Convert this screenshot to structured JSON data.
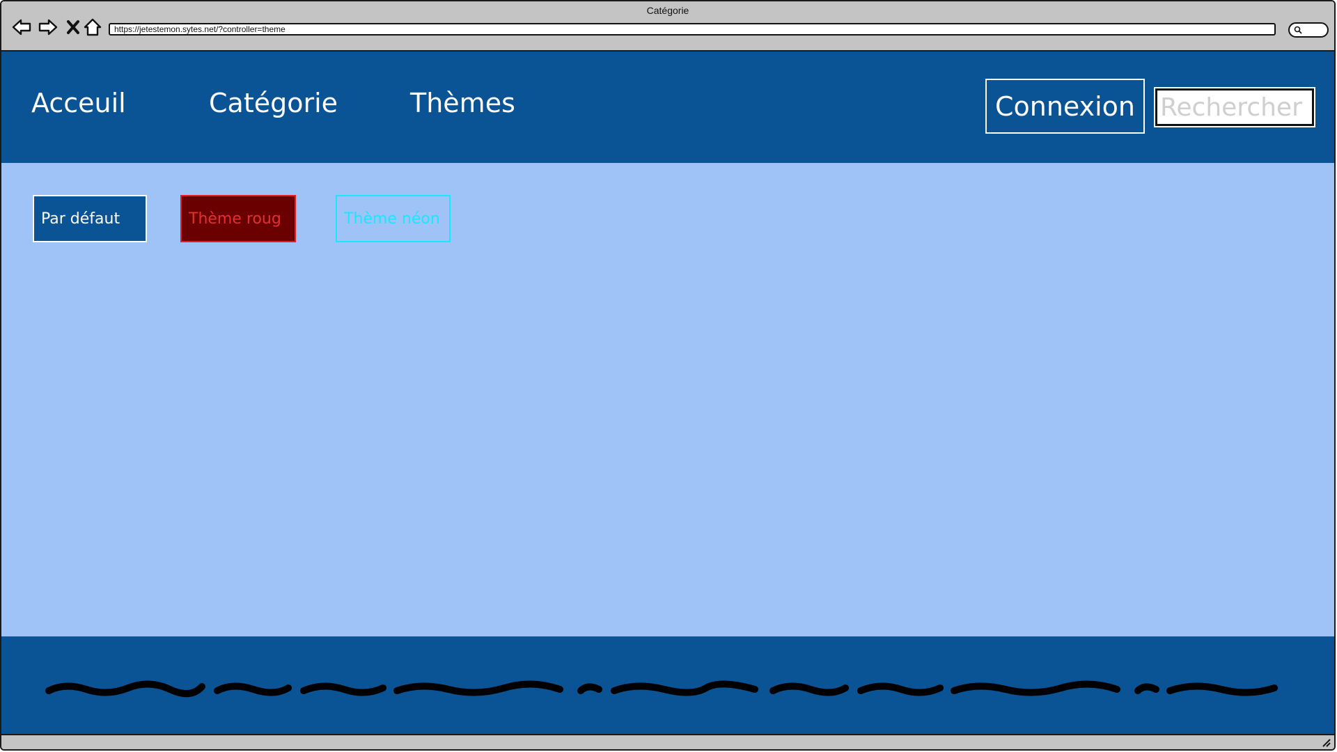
{
  "browser": {
    "window_title": "Catégorie",
    "url": "https://jetestemon.sytes.net/?controller=theme",
    "icons": [
      "back-arrow-icon",
      "forward-arrow-icon",
      "close-x-icon",
      "home-icon",
      "search-icon",
      "resize-grip-icon"
    ]
  },
  "header": {
    "nav": [
      {
        "label": "Acceuil"
      },
      {
        "label": "Catégorie"
      },
      {
        "label": "Thèmes"
      }
    ],
    "login_label": "Connexion",
    "search_placeholder": "Rechercher",
    "background_color": "#0a5395"
  },
  "themes": {
    "buttons": [
      {
        "label": "Par défaut",
        "background": "#0a5395",
        "text_color": "#ffffff"
      },
      {
        "label": "Thème roug",
        "background": "#6b0000",
        "text_color": "#e03030"
      },
      {
        "label": "Thème néon",
        "background": "transparent",
        "text_color": "#19e6ff"
      }
    ],
    "content_background": "#9fc3f7"
  },
  "footer": {
    "background_color": "#0a5395"
  }
}
